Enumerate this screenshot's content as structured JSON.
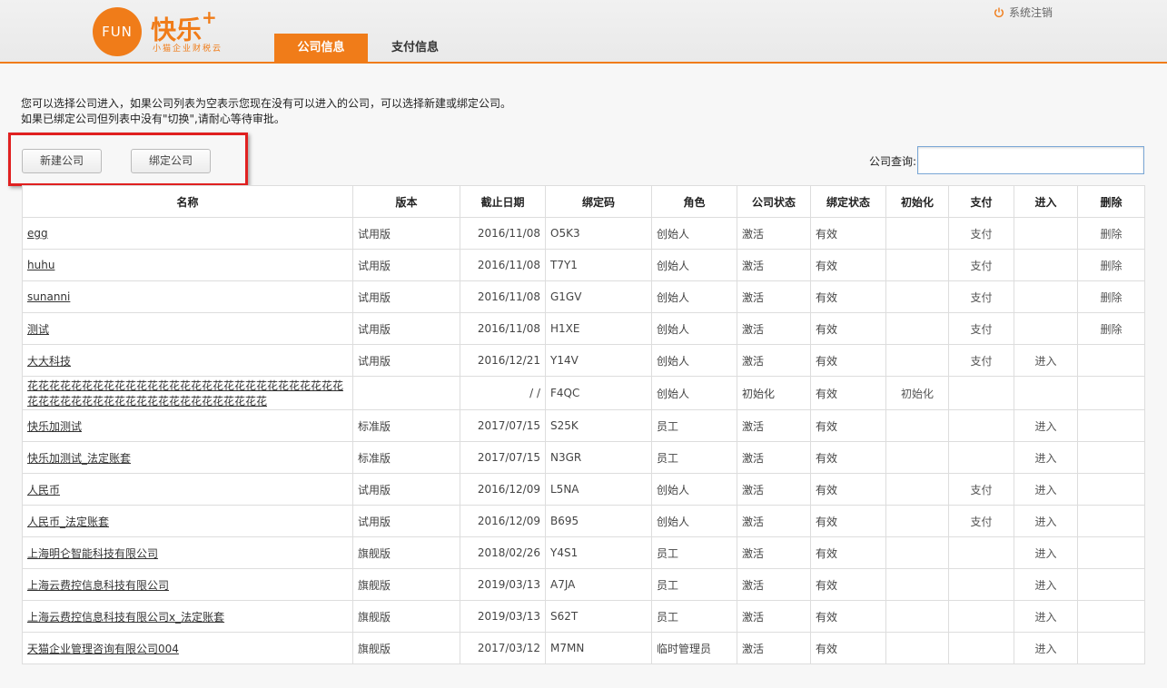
{
  "header": {
    "logo_text": "FUN",
    "logo_title": "快乐",
    "logo_plus": "+",
    "logo_sub": "小猫企业财税云",
    "tabs": [
      {
        "label": "公司信息"
      },
      {
        "label": "支付信息"
      }
    ],
    "logout_label": "系统注销",
    "accent_color": "#f07c19"
  },
  "notice": {
    "line1": "您可以选择公司进入，如果公司列表为空表示您现在没有可以进入的公司，可以选择新建或绑定公司。",
    "line2": "如果已绑定公司但列表中没有\"切换\",请耐心等待审批。"
  },
  "actions": {
    "new_company": "新建公司",
    "bind_company": "绑定公司"
  },
  "search": {
    "label": "公司查询:",
    "value": ""
  },
  "table": {
    "headers": [
      "名称",
      "版本",
      "截止日期",
      "绑定码",
      "角色",
      "公司状态",
      "绑定状态",
      "初始化",
      "支付",
      "进入",
      "删除"
    ],
    "rows": [
      {
        "name": "egg",
        "version": "试用版",
        "date": "2016/11/08",
        "code": "O5K3",
        "role": "创始人",
        "status": "激活",
        "bind": "有效",
        "init": "",
        "pay": "支付",
        "enter": "",
        "del": "删除"
      },
      {
        "name": "huhu",
        "version": "试用版",
        "date": "2016/11/08",
        "code": "T7Y1",
        "role": "创始人",
        "status": "激活",
        "bind": "有效",
        "init": "",
        "pay": "支付",
        "enter": "",
        "del": "删除"
      },
      {
        "name": "sunanni",
        "version": "试用版",
        "date": "2016/11/08",
        "code": "G1GV",
        "role": "创始人",
        "status": "激活",
        "bind": "有效",
        "init": "",
        "pay": "支付",
        "enter": "",
        "del": "删除"
      },
      {
        "name": "测试",
        "version": "试用版",
        "date": "2016/11/08",
        "code": "H1XE",
        "role": "创始人",
        "status": "激活",
        "bind": "有效",
        "init": "",
        "pay": "支付",
        "enter": "",
        "del": "删除"
      },
      {
        "name": "大大科技",
        "version": "试用版",
        "date": "2016/12/21",
        "code": "Y14V",
        "role": "创始人",
        "status": "激活",
        "bind": "有效",
        "init": "",
        "pay": "支付",
        "enter": "进入",
        "del": ""
      },
      {
        "name": "花花花花花花花花花花花花花花花花花花花花花花花花花花花花花花花花花花花花花花花花花花花花花花花花花花花",
        "version": "",
        "date": "/ /",
        "code": "F4QC",
        "role": "创始人",
        "status": "初始化",
        "bind": "有效",
        "init": "初始化",
        "pay": "",
        "enter": "",
        "del": ""
      },
      {
        "name": "快乐加测试",
        "version": "标准版",
        "date": "2017/07/15",
        "code": "S25K",
        "role": "员工",
        "status": "激活",
        "bind": "有效",
        "init": "",
        "pay": "",
        "enter": "进入",
        "del": ""
      },
      {
        "name": "快乐加测试_法定账套",
        "version": "标准版",
        "date": "2017/07/15",
        "code": "N3GR",
        "role": "员工",
        "status": "激活",
        "bind": "有效",
        "init": "",
        "pay": "",
        "enter": "进入",
        "del": ""
      },
      {
        "name": "人民币",
        "version": "试用版",
        "date": "2016/12/09",
        "code": "L5NA",
        "role": "创始人",
        "status": "激活",
        "bind": "有效",
        "init": "",
        "pay": "支付",
        "enter": "进入",
        "del": ""
      },
      {
        "name": "人民币_法定账套",
        "version": "试用版",
        "date": "2016/12/09",
        "code": "B695",
        "role": "创始人",
        "status": "激活",
        "bind": "有效",
        "init": "",
        "pay": "支付",
        "enter": "进入",
        "del": ""
      },
      {
        "name": "上海明仑智能科技有限公司",
        "version": "旗舰版",
        "date": "2018/02/26",
        "code": "Y4S1",
        "role": "员工",
        "status": "激活",
        "bind": "有效",
        "init": "",
        "pay": "",
        "enter": "进入",
        "del": ""
      },
      {
        "name": "上海云费控信息科技有限公司",
        "version": "旗舰版",
        "date": "2019/03/13",
        "code": "A7JA",
        "role": "员工",
        "status": "激活",
        "bind": "有效",
        "init": "",
        "pay": "",
        "enter": "进入",
        "del": ""
      },
      {
        "name": "上海云费控信息科技有限公司x_法定账套",
        "version": "旗舰版",
        "date": "2019/03/13",
        "code": "S62T",
        "role": "员工",
        "status": "激活",
        "bind": "有效",
        "init": "",
        "pay": "",
        "enter": "进入",
        "del": ""
      },
      {
        "name": "天猫企业管理咨询有限公司004",
        "version": "旗舰版",
        "date": "2017/03/12",
        "code": "M7MN",
        "role": "临时管理员",
        "status": "激活",
        "bind": "有效",
        "init": "",
        "pay": "",
        "enter": "进入",
        "del": ""
      }
    ]
  }
}
